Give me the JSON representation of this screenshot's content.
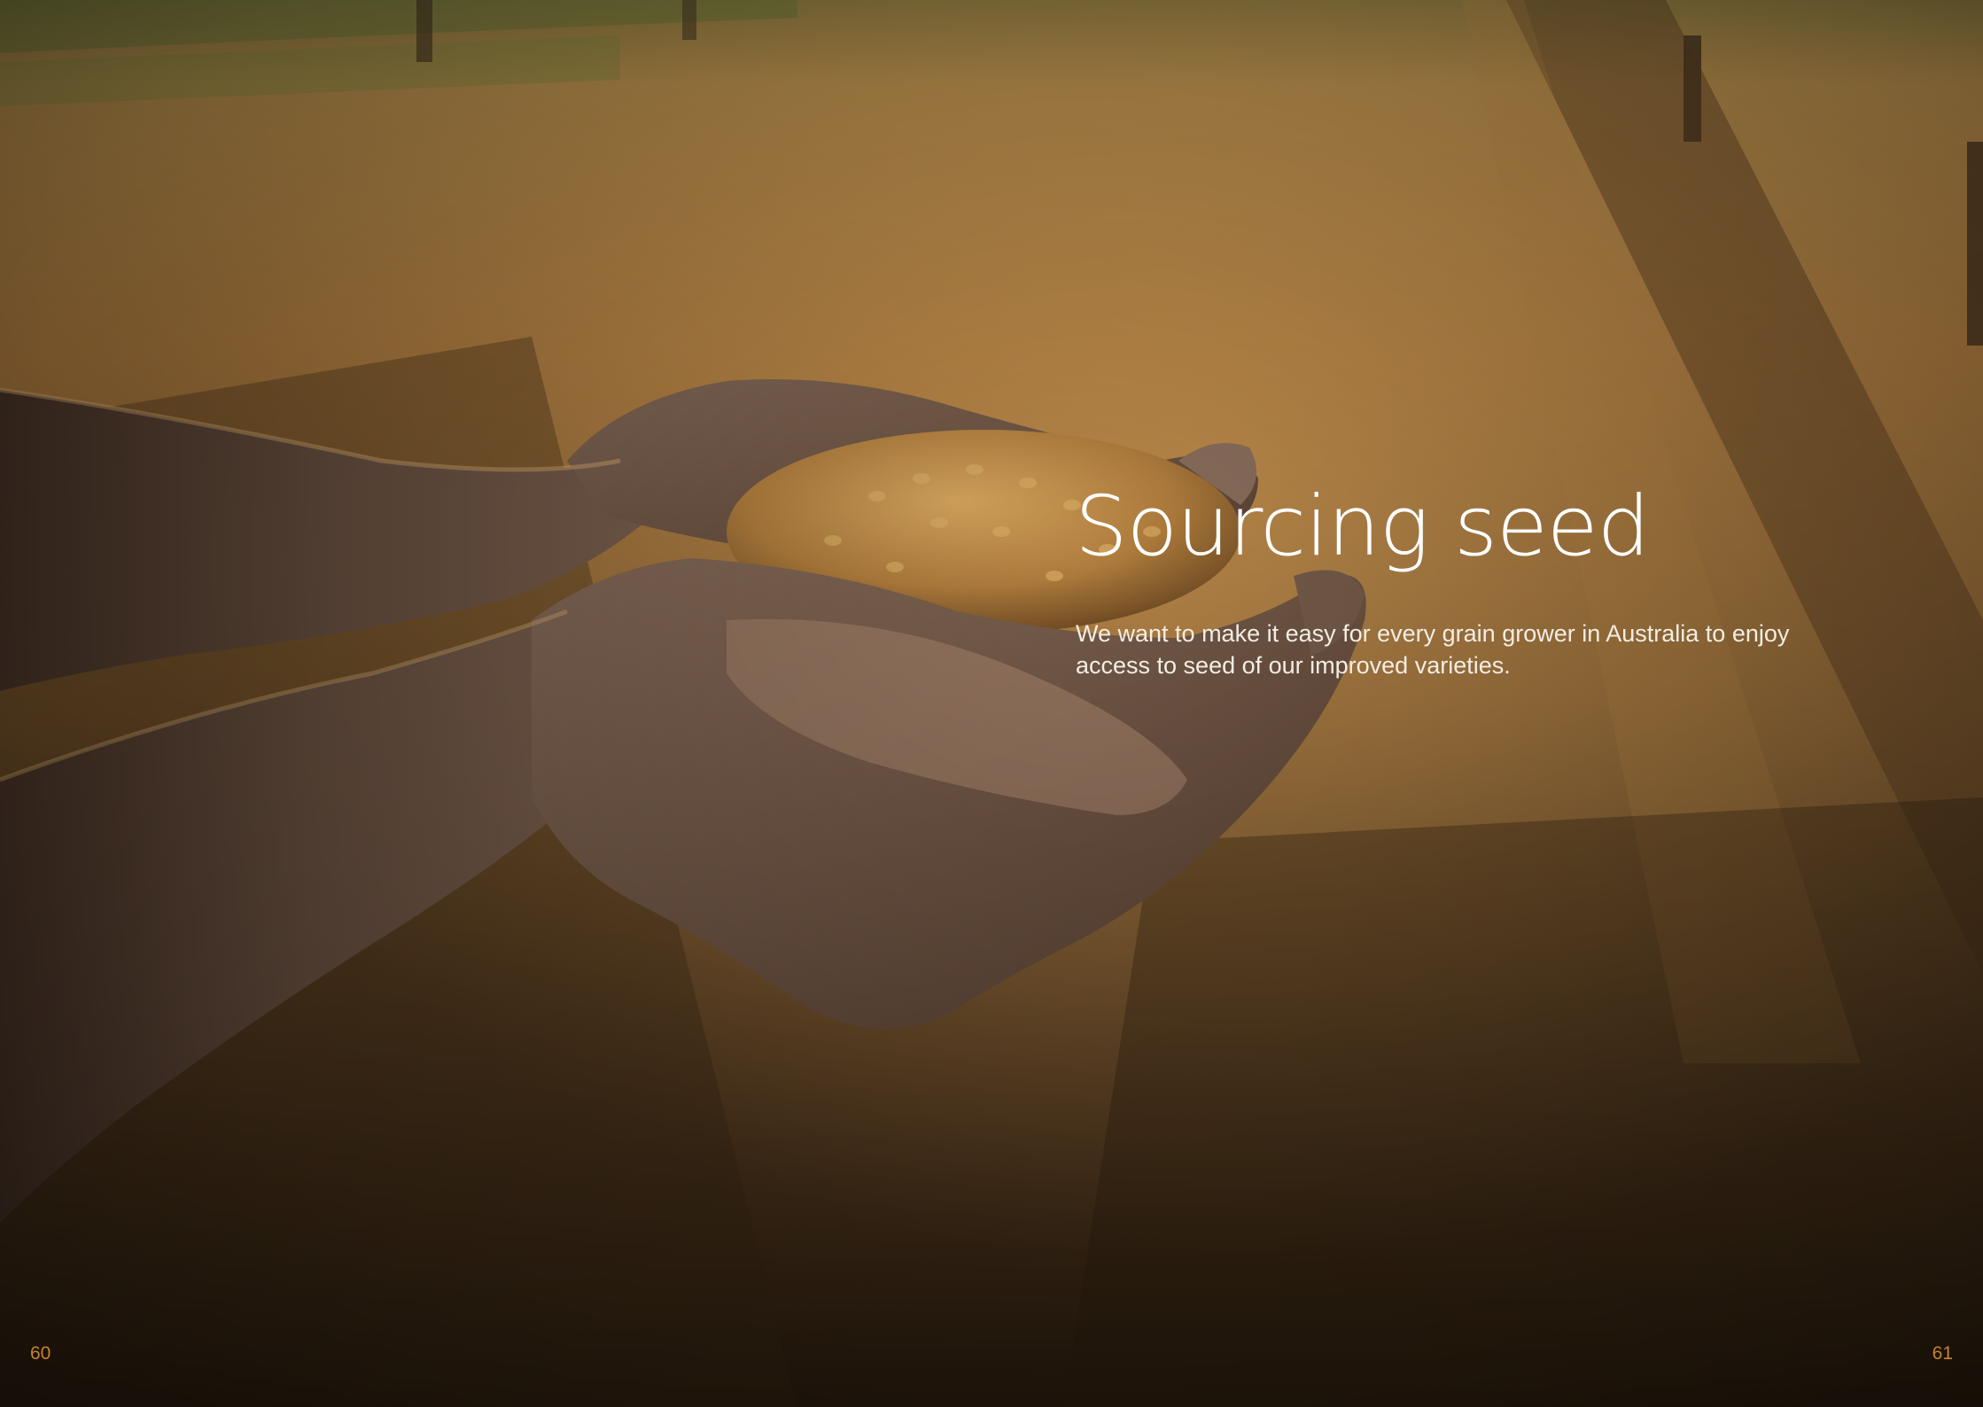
{
  "heading": "Sourcing seed",
  "intro_line_1": "We want to make it easy for every grain grower in Australia to enjoy",
  "intro_line_2": "access to seed of our improved varieties.",
  "page_numbers": {
    "left": "60",
    "right": "61"
  },
  "colors": {
    "heading": "#ffffff",
    "body_text": "#f3ede3",
    "page_number": "#c8822e",
    "field_light": "#b8843d",
    "field_dark": "#2e1f10",
    "skin": "#8a6d58",
    "grain": "#c99547"
  }
}
